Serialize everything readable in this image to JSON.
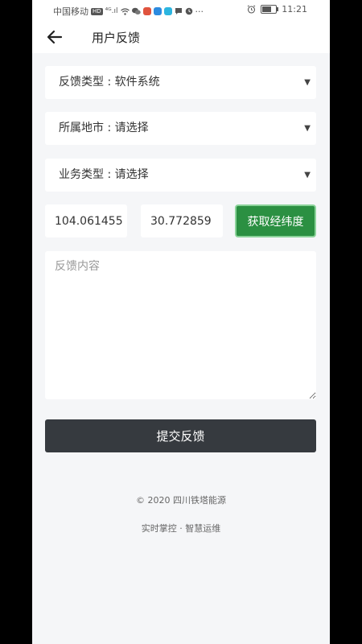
{
  "status_bar": {
    "carrier": "中国移动",
    "hd_badge": "HD",
    "signal_text": "⁴ᴳ.ıl",
    "more": "···",
    "time": "11:21"
  },
  "header": {
    "title": "用户反馈"
  },
  "form": {
    "feedback_type": "反馈类型 : 软件系统",
    "city": "所属地市 : 请选择",
    "business_type": "业务类型 : 请选择",
    "caret": "▼",
    "longitude": "104.061455",
    "latitude": "30.772859",
    "get_coords_label": "获取经纬度",
    "content_placeholder": "反馈内容",
    "submit_label": "提交反馈"
  },
  "footer": {
    "copyright": "© 2020 四川铁塔能源",
    "slogan": "实时掌控 · 智慧运维"
  },
  "colors": {
    "accent_green": "#2b9042",
    "submit_dark": "#363a3f"
  }
}
